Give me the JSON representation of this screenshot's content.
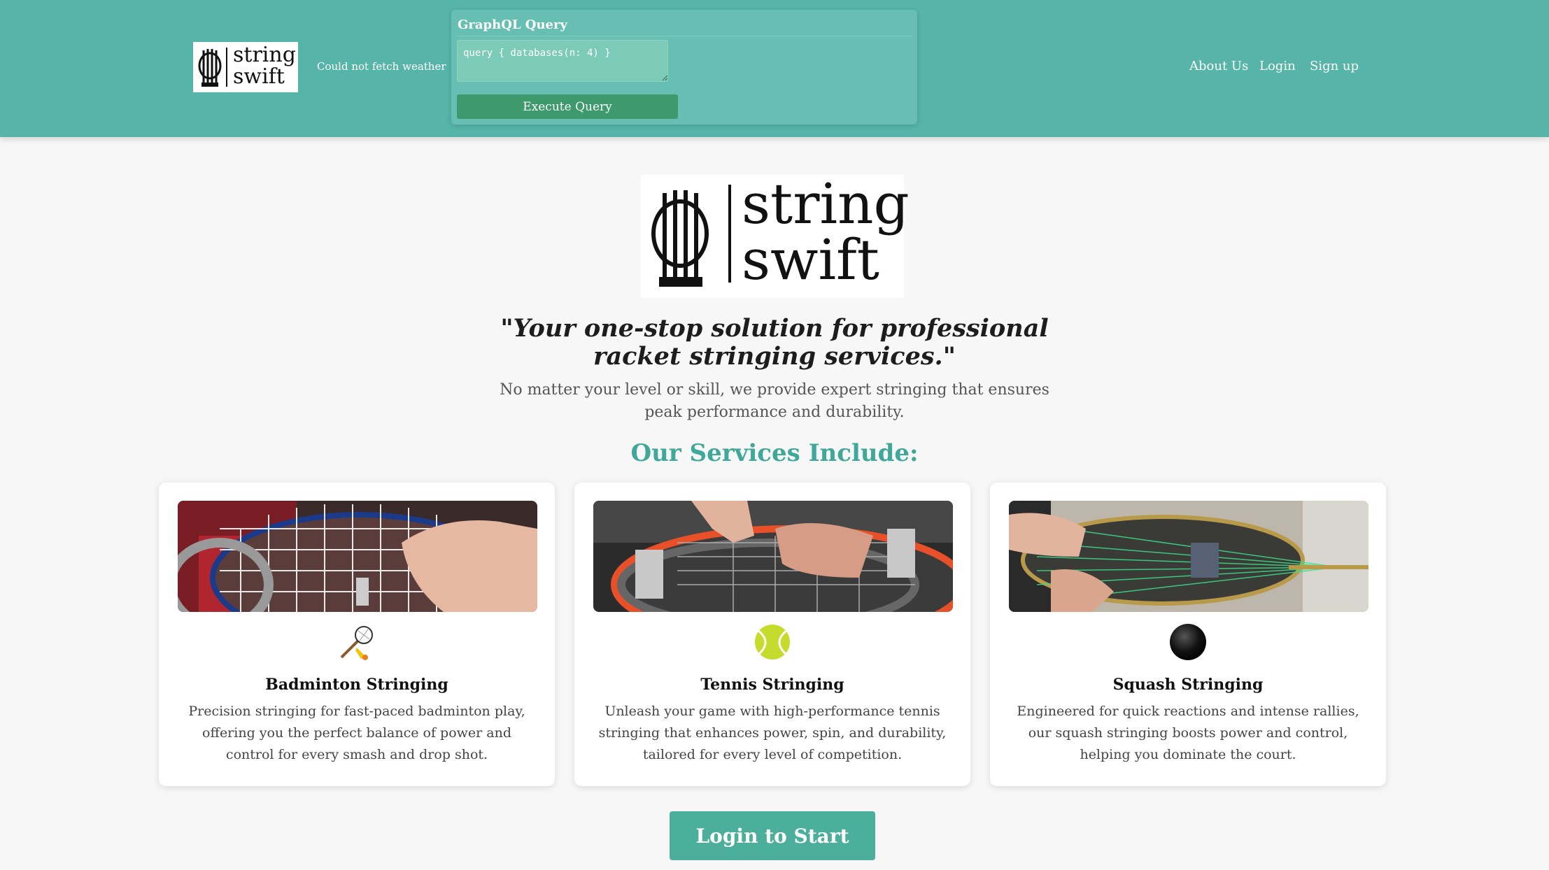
{
  "header": {
    "logo_line1": "string",
    "logo_line2": "swift",
    "weather_status": "Could not fetch weather",
    "graphql": {
      "title": "GraphQL Query",
      "query_value": "query { databases(n: 4) }",
      "execute_label": "Execute Query"
    },
    "nav": {
      "about": "About Us",
      "login": "Login",
      "signup": "Sign up"
    }
  },
  "hero": {
    "logo_line1": "string",
    "logo_line2": "swift",
    "tagline": "\"Your one-stop solution for professional racket stringing services.\"",
    "subtitle": "No matter your level or skill, we provide expert stringing that ensures peak performance and durability."
  },
  "services": {
    "heading": "Our Services Include:",
    "cards": [
      {
        "title": "Badminton Stringing",
        "description": "Precision stringing for fast-paced badminton play, offering you the perfect balance of power and control for every smash and drop shot.",
        "icon": "badminton-icon"
      },
      {
        "title": "Tennis Stringing",
        "description": "Unleash your game with high-performance tennis stringing that enhances power, spin, and durability, tailored for every level of competition.",
        "icon": "tennis-ball-icon"
      },
      {
        "title": "Squash Stringing",
        "description": "Engineered for quick reactions and intense rallies, our squash stringing boosts power and control, helping you dominate the court.",
        "icon": "squash-ball-icon"
      }
    ]
  },
  "cta": {
    "label": "Login to Start"
  },
  "colors": {
    "header_bg": "#56b5a8",
    "accent": "#3fa899",
    "execute_button": "#3c9a6c",
    "cta_button": "#4caf9c"
  }
}
